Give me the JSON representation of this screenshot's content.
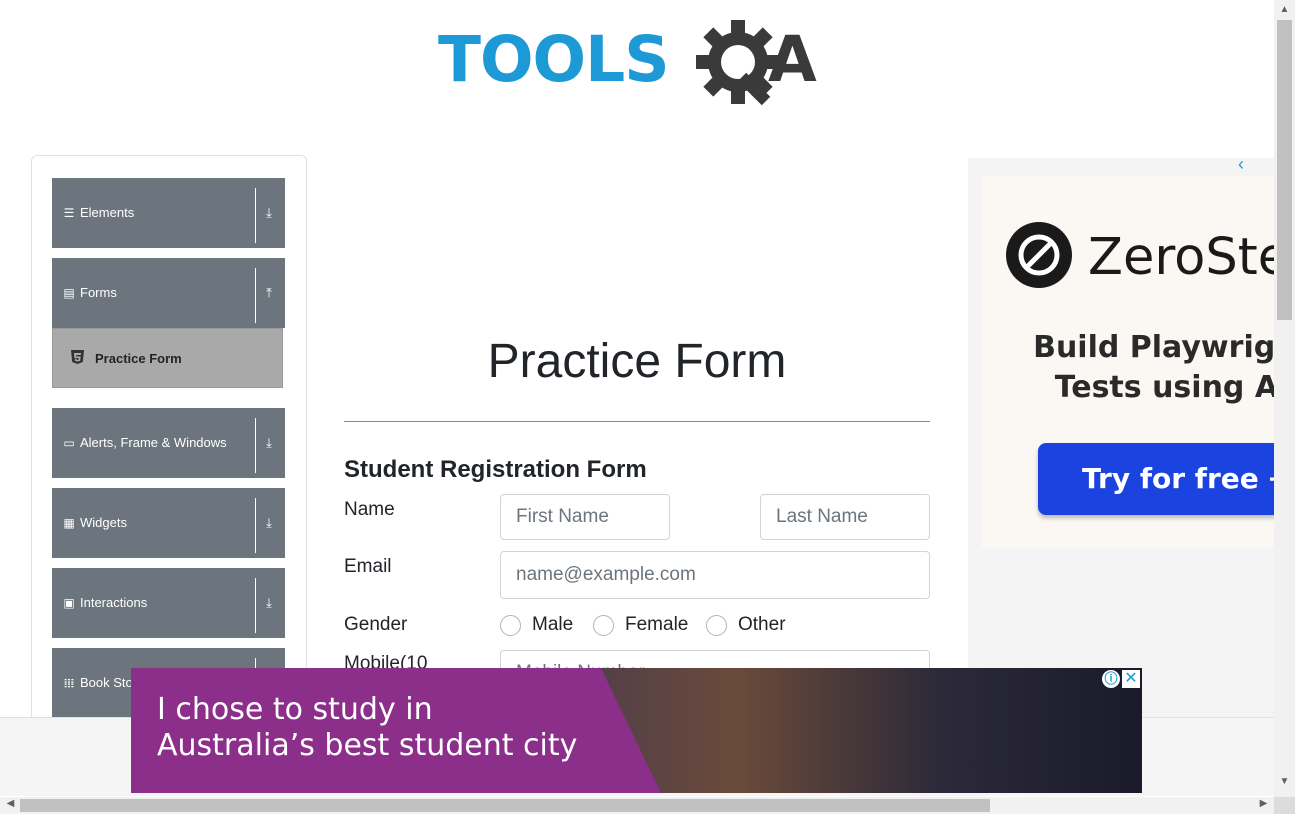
{
  "logo": {
    "text": "TOOLS",
    "text_end": "A",
    "alt": "TOOLSQA"
  },
  "sidebar": {
    "groups": [
      {
        "label": "Elements",
        "icon": "hamburger-icon",
        "arrow": "⤓"
      },
      {
        "label": "Forms",
        "icon": "document-icon",
        "arrow": "⤒"
      },
      {
        "label": "Alerts, Frame & Windows",
        "icon": "window-icon",
        "arrow": "⤓"
      },
      {
        "label": "Widgets",
        "icon": "grid-icon",
        "arrow": "⤓"
      },
      {
        "label": "Interactions",
        "icon": "cursor-box-icon",
        "arrow": "⤓"
      },
      {
        "label": "Book Store Application",
        "icon": "books-icon",
        "arrow": "⤓"
      }
    ],
    "active_item": {
      "label": "Practice Form",
      "icon": "html5-icon"
    }
  },
  "main": {
    "title": "Practice Form",
    "form_title": "Student Registration Form",
    "name_label": "Name",
    "first_name_placeholder": "First Name",
    "last_name_placeholder": "Last Name",
    "email_label": "Email",
    "email_placeholder": "name@example.com",
    "gender_label": "Gender",
    "gender_options": [
      "Male",
      "Female",
      "Other"
    ],
    "mobile_label": "Mobile(10",
    "mobile_placeholder": "Mobile Number"
  },
  "right_ad": {
    "brand": "ZeroStep",
    "tagline_line1": "Build Playwright",
    "tagline_line2": "Tests using AI",
    "button": "Try for free →",
    "back_icon": "‹"
  },
  "bottom_ad": {
    "line1": "I chose to study in",
    "line2": "Australia’s best student city",
    "info_icon": "ⓘ",
    "close_icon": "✕"
  },
  "colors": {
    "sidebar_group_bg": "#6c757d",
    "active_item_bg": "#a9a9a9",
    "logo_blue": "#1d9ad6",
    "ad_purple": "#8b2f8a",
    "ad_button_blue": "#1a43e0"
  }
}
